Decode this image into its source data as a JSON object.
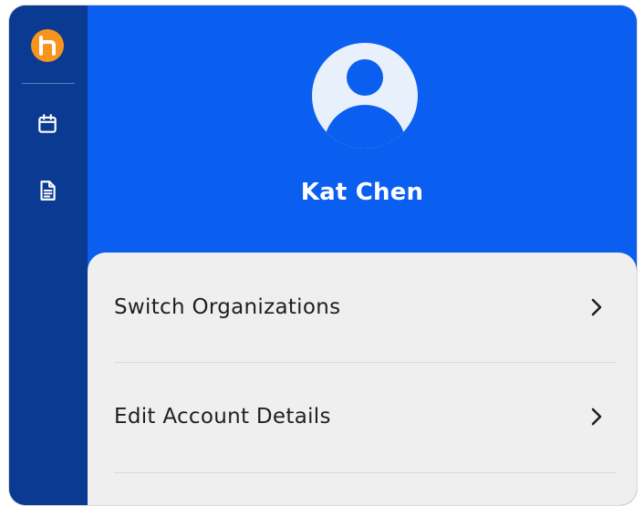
{
  "sidebar": {
    "logo_icon": "app-logo-icon",
    "items": [
      {
        "icon": "calendar-icon"
      },
      {
        "icon": "document-icon"
      }
    ]
  },
  "profile": {
    "avatar_icon": "user-avatar-icon",
    "name": "Kat Chen"
  },
  "menu": {
    "items": [
      {
        "label": "Switch Organizations",
        "icon": "chevron-right-icon"
      },
      {
        "label": "Edit Account Details",
        "icon": "chevron-right-icon"
      }
    ]
  },
  "colors": {
    "brand_blue": "#0a5ef0",
    "sidebar_navy": "#0b3a93",
    "logo_orange": "#f7941d",
    "panel_bg": "#efefef"
  }
}
